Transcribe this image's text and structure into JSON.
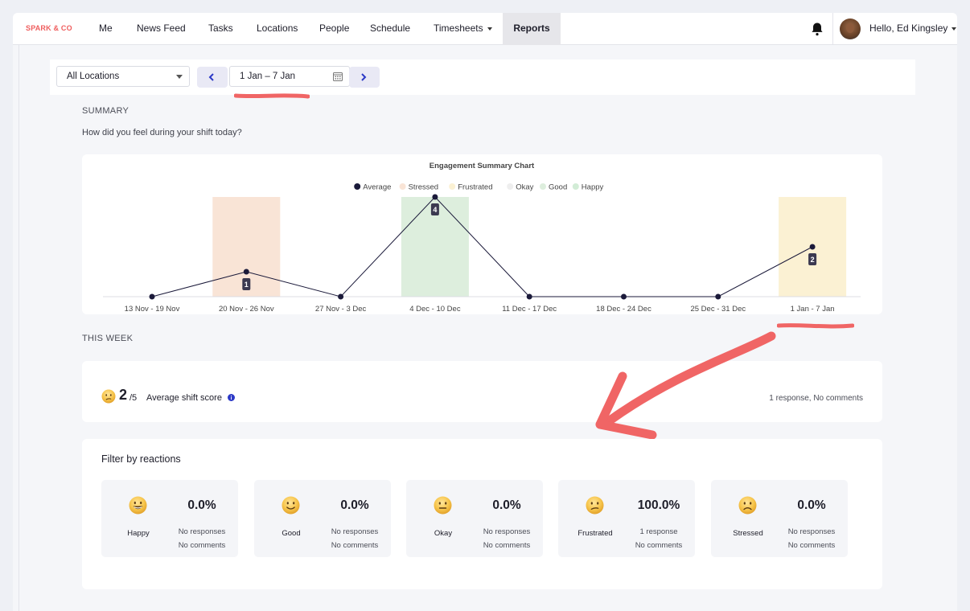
{
  "nav": {
    "brand": "SPARK & CO",
    "items": [
      {
        "label": "Me"
      },
      {
        "label": "News Feed"
      },
      {
        "label": "Tasks"
      },
      {
        "label": "Locations"
      },
      {
        "label": "People"
      },
      {
        "label": "Schedule"
      },
      {
        "label": "Timesheets"
      },
      {
        "label": "Reports",
        "active": true
      }
    ],
    "greeting": "Hello, Ed Kingsley",
    "bell_icon": "bell-icon"
  },
  "filters": {
    "location": "All Locations",
    "date_range": "1 Jan – 7 Jan"
  },
  "summary": {
    "label": "SUMMARY",
    "question": "How did you feel during your shift today?"
  },
  "chart_data": {
    "type": "line",
    "title": "Engagement Summary Chart",
    "legend": [
      {
        "name": "Average",
        "color": "#1b1a3a"
      },
      {
        "name": "Stressed",
        "color": "#f9e4d6"
      },
      {
        "name": "Frustrated",
        "color": "#fbf1d3"
      },
      {
        "name": "Okay",
        "color": "#eeeeee"
      },
      {
        "name": "Good",
        "color": "#ddeedd"
      },
      {
        "name": "Happy",
        "color": "#d2ecd6"
      }
    ],
    "legend_position": "top-center",
    "categories": [
      "13 Nov - 19 Nov",
      "20 Nov - 26 Nov",
      "27 Nov - 3 Dec",
      "4 Dec - 10 Dec",
      "11 Dec - 17 Dec",
      "18 Dec - 24 Dec",
      "25 Dec - 31 Dec",
      "1 Jan - 7 Jan"
    ],
    "series": [
      {
        "name": "Average",
        "values": [
          0,
          1,
          0,
          4,
          0,
          0,
          0,
          2
        ]
      }
    ],
    "data_labels": [
      null,
      "1",
      null,
      "4",
      null,
      null,
      null,
      "2"
    ],
    "band_reactions": [
      null,
      "Stressed",
      null,
      "Good",
      null,
      null,
      null,
      "Frustrated"
    ],
    "ylim": [
      0,
      4
    ]
  },
  "this_week": {
    "label": "THIS WEEK",
    "score": "2",
    "score_max": "/5",
    "score_label": "Average shift score",
    "responses": "1 response, No comments"
  },
  "reactions": {
    "title": "Filter by reactions",
    "items": [
      {
        "name": "Happy",
        "percent": "0.0%",
        "responses": "No responses",
        "comments": "No comments",
        "icon": "grinning-face-icon"
      },
      {
        "name": "Good",
        "percent": "0.0%",
        "responses": "No responses",
        "comments": "No comments",
        "icon": "slightly-smiling-face-icon"
      },
      {
        "name": "Okay",
        "percent": "0.0%",
        "responses": "No responses",
        "comments": "No comments",
        "icon": "neutral-face-icon"
      },
      {
        "name": "Frustrated",
        "percent": "100.0%",
        "responses": "1 response",
        "comments": "No comments",
        "icon": "confused-face-icon"
      },
      {
        "name": "Stressed",
        "percent": "0.0%",
        "responses": "No responses",
        "comments": "No comments",
        "icon": "frowning-face-icon"
      }
    ]
  }
}
